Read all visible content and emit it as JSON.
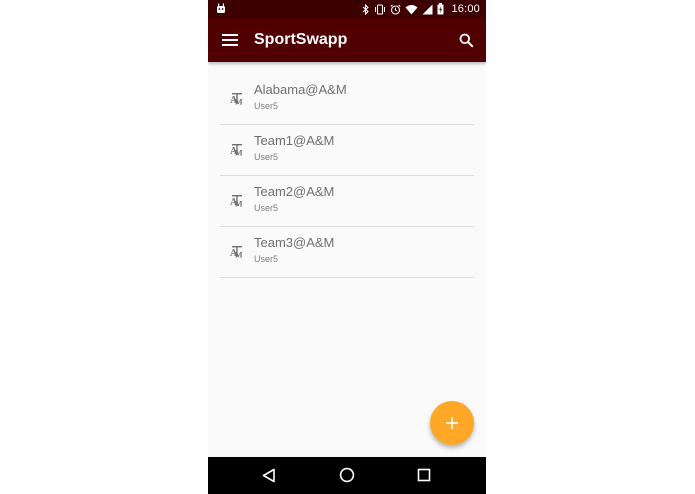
{
  "status_bar": {
    "time": "16:00",
    "left_icon": "android-notification-icon",
    "icons": [
      "bluetooth-icon",
      "vibrate-icon",
      "alarm-icon",
      "wifi-icon",
      "signal-icon",
      "battery-icon"
    ]
  },
  "app_bar": {
    "title": "SportSwapp",
    "menu_icon": "hamburger-menu-icon",
    "search_icon": "search-icon"
  },
  "list": {
    "items": [
      {
        "title": "Alabama@A&M",
        "subtitle": "User5",
        "icon": "atm-logo-icon"
      },
      {
        "title": "Team1@A&M",
        "subtitle": "User5",
        "icon": "atm-logo-icon"
      },
      {
        "title": "Team2@A&M",
        "subtitle": "User5",
        "icon": "atm-logo-icon"
      },
      {
        "title": "Team3@A&M",
        "subtitle": "User5",
        "icon": "atm-logo-icon"
      }
    ]
  },
  "fab": {
    "icon": "plus-icon"
  },
  "nav_bar": {
    "icons": [
      "back-triangle-icon",
      "home-circle-icon",
      "recents-square-icon"
    ]
  },
  "colors": {
    "status_bar": "#3c0000",
    "app_bar": "#500000",
    "fab": "#ffa726",
    "background": "#fafafa",
    "divider": "#dcdcdc"
  }
}
